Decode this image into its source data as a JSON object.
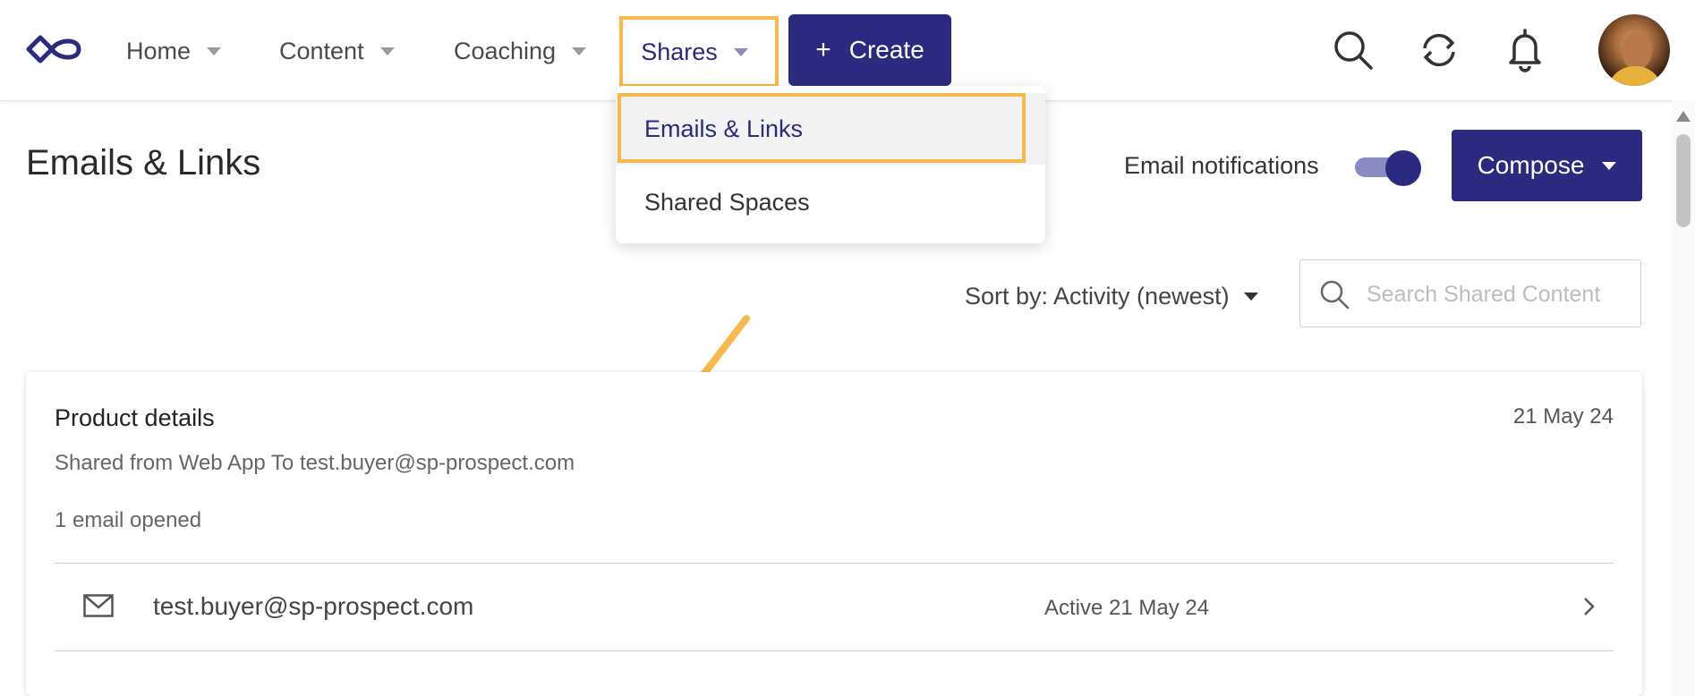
{
  "nav": {
    "items": [
      {
        "label": "Home"
      },
      {
        "label": "Content"
      },
      {
        "label": "Coaching"
      },
      {
        "label": "Shares"
      }
    ],
    "create_label": "Create",
    "icons": [
      "search-icon",
      "sync-icon",
      "bell-icon"
    ]
  },
  "dropdown": {
    "items": [
      {
        "label": "Emails & Links"
      },
      {
        "label": "Shared Spaces"
      }
    ]
  },
  "page": {
    "title": "Emails & Links",
    "notifications_label": "Email notifications",
    "notifications_on": true,
    "compose_label": "Compose"
  },
  "toolbar": {
    "sort_label": "Sort by: Activity (newest)",
    "search_placeholder": "Search Shared Content"
  },
  "card": {
    "title": "Product details",
    "date": "21 May 24",
    "shared_text": "Shared from Web App To test.buyer@sp-prospect.com",
    "opened_text": "1 email opened",
    "recipient": {
      "email": "test.buyer@sp-prospect.com",
      "active": "Active 21 May 24"
    }
  },
  "colors": {
    "brand": "#2b2a80",
    "highlight": "#f6b94a"
  }
}
